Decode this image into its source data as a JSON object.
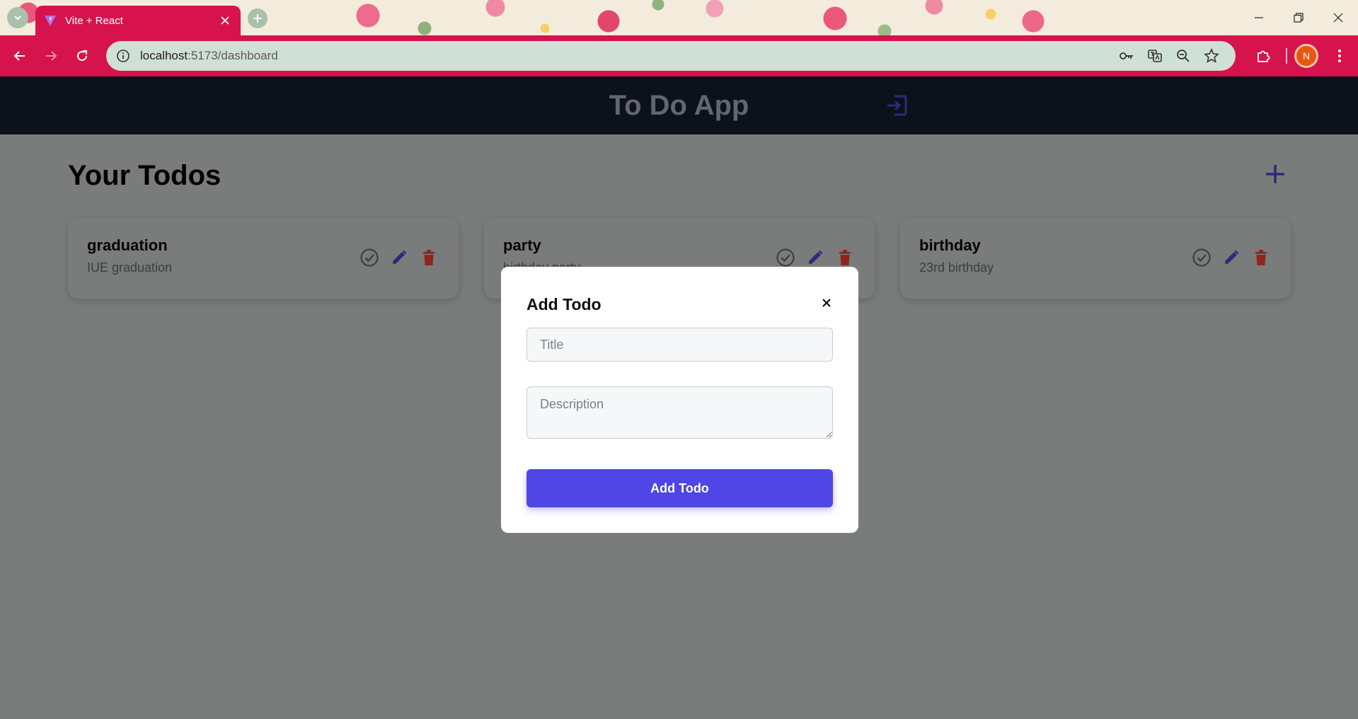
{
  "browser": {
    "tab_title": "Vite + React",
    "url_host": "localhost",
    "url_path": ":5173/dashboard",
    "profile_initial": "N"
  },
  "app": {
    "title": "To Do App",
    "heading": "Your Todos",
    "todos": [
      {
        "title": "graduation",
        "description": "IUE graduation"
      },
      {
        "title": "party",
        "description": "birthday party"
      },
      {
        "title": "birthday",
        "description": "23rd birthday"
      }
    ]
  },
  "modal": {
    "title": "Add Todo",
    "title_placeholder": "Title",
    "description_placeholder": "Description",
    "submit_label": "Add Todo"
  },
  "colors": {
    "accent": "#4f46e5",
    "browser_chrome": "#d6134d",
    "header_bg": "#0c111b",
    "overlay": "#7a7c7b",
    "delete": "#b3261e"
  }
}
